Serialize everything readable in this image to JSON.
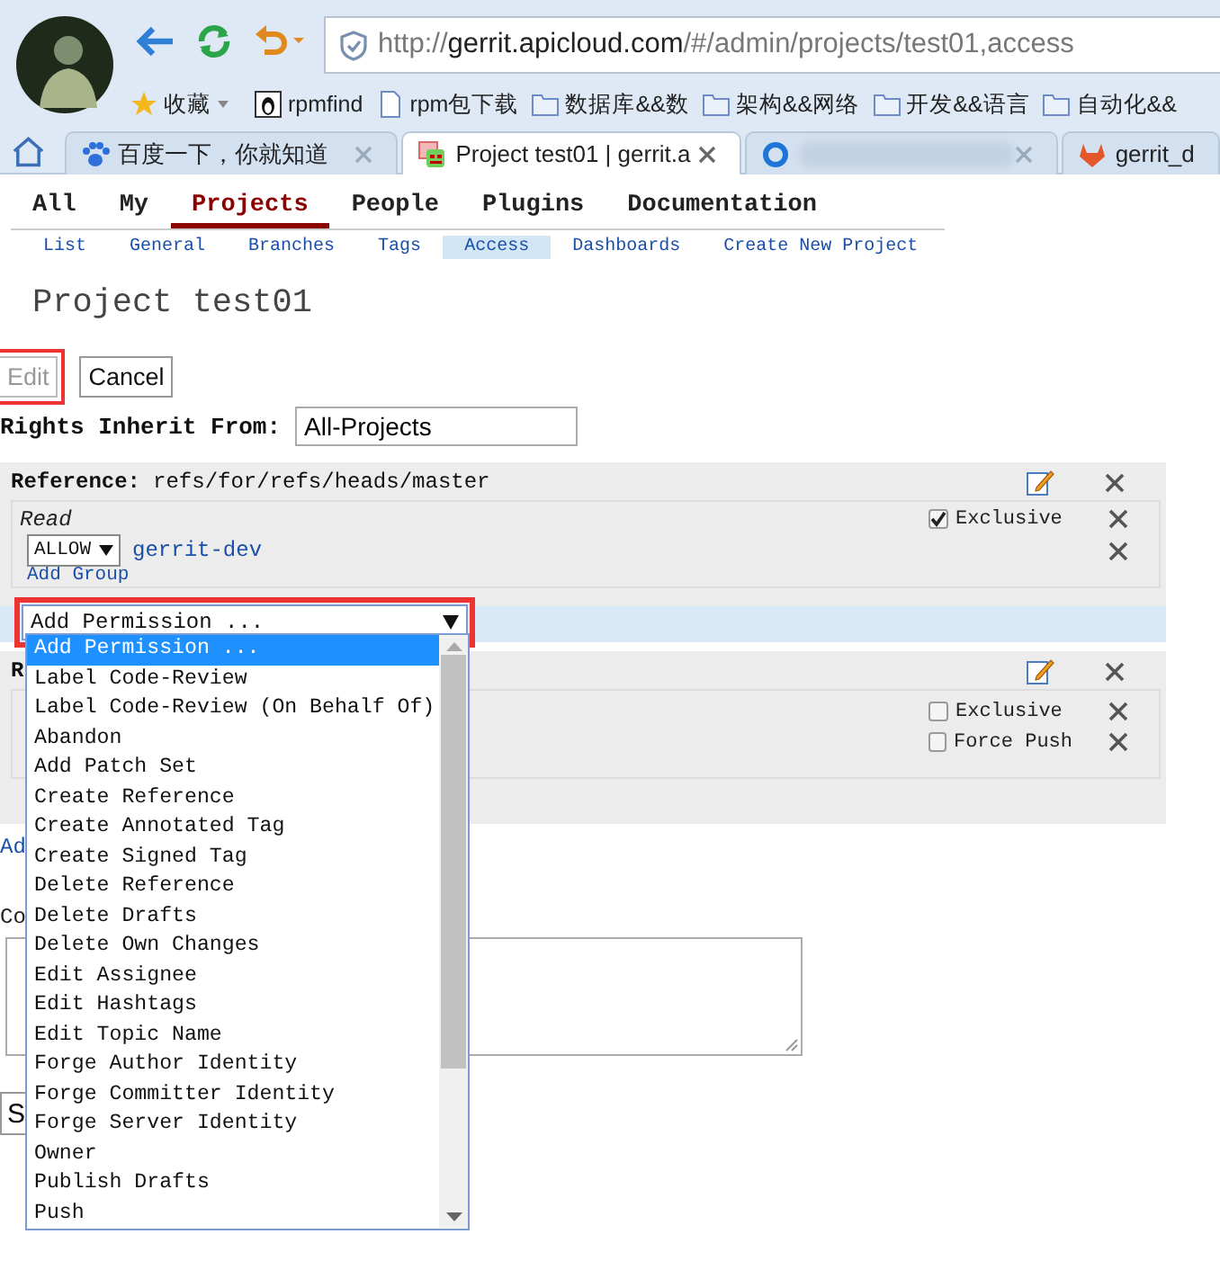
{
  "browser": {
    "address": {
      "scheme": "http://",
      "host": "gerrit.apicloud.com",
      "path": "/#/admin/projects/test01,access"
    },
    "bookmarks": [
      {
        "label": "收藏",
        "kind": "star"
      },
      {
        "label": "rpmfind",
        "kind": "site"
      },
      {
        "label": "rpm包下载",
        "kind": "page"
      },
      {
        "label": "数据库&&数",
        "kind": "folder"
      },
      {
        "label": "架构&&网络",
        "kind": "folder"
      },
      {
        "label": "开发&&语言",
        "kind": "folder"
      },
      {
        "label": "自动化&&",
        "kind": "folder"
      }
    ],
    "tabs": [
      {
        "title": "百度一下，你就知道",
        "kind": "paw",
        "selected": false
      },
      {
        "title": "Project test01 | gerrit.a",
        "kind": "gerrit",
        "selected": true
      },
      {
        "kind": "blurred",
        "selected": false
      },
      {
        "title": "gerrit_d",
        "kind": "fox",
        "selected": false
      }
    ]
  },
  "nav": [
    {
      "label": "All",
      "selected": false
    },
    {
      "label": "My",
      "selected": false
    },
    {
      "label": "Projects",
      "selected": true
    },
    {
      "label": "People",
      "selected": false
    },
    {
      "label": "Plugins",
      "selected": false
    },
    {
      "label": "Documentation",
      "selected": false
    }
  ],
  "subnav": [
    {
      "label": "List",
      "selected": false
    },
    {
      "label": "General",
      "selected": false
    },
    {
      "label": "Branches",
      "selected": false
    },
    {
      "label": "Tags",
      "selected": false
    },
    {
      "label": "Access",
      "selected": true
    },
    {
      "label": "Dashboards",
      "selected": false
    },
    {
      "label": "Create New Project",
      "selected": false
    }
  ],
  "title": "Project test01",
  "buttons": [
    {
      "label": "Edit",
      "disabled": true,
      "highlighted": true
    },
    {
      "label": "Cancel",
      "disabled": false,
      "highlighted": false
    }
  ],
  "inherit": {
    "label": "Rights Inherit From:",
    "value": "All-Projects"
  },
  "references": [
    {
      "label": "Reference:",
      "pattern": "refs/for/refs/heads/master",
      "permission": {
        "name": "Read",
        "options": [
          {
            "label": "Exclusive",
            "checked": true
          }
        ],
        "rules": [
          {
            "action": "ALLOW",
            "group": "gerrit-dev"
          }
        ],
        "add_group": "Add Group"
      },
      "add_permission": {
        "value": "Add Permission ...",
        "highlighted": true
      }
    },
    {
      "label": "R",
      "permission": {
        "options": [
          {
            "label": "Exclusive",
            "checked": false
          },
          {
            "label": "Force Push",
            "checked": false
          }
        ]
      }
    }
  ],
  "add_reference": "Ad",
  "comment_label": "Co",
  "save_button": "S",
  "dropdown": {
    "options": [
      {
        "label": "Add Permission ...",
        "selected": true
      },
      {
        "label": "Label Code-Review",
        "selected": false
      },
      {
        "label": "Label Code-Review (On Behalf Of)",
        "selected": false
      },
      {
        "label": "Abandon",
        "selected": false
      },
      {
        "label": "Add Patch Set",
        "selected": false
      },
      {
        "label": "Create Reference",
        "selected": false
      },
      {
        "label": "Create Annotated Tag",
        "selected": false
      },
      {
        "label": "Create Signed Tag",
        "selected": false
      },
      {
        "label": "Delete Reference",
        "selected": false
      },
      {
        "label": "Delete Drafts",
        "selected": false
      },
      {
        "label": "Delete Own Changes",
        "selected": false
      },
      {
        "label": "Edit Assignee",
        "selected": false
      },
      {
        "label": "Edit Hashtags",
        "selected": false
      },
      {
        "label": "Edit Topic Name",
        "selected": false
      },
      {
        "label": "Forge Author Identity",
        "selected": false
      },
      {
        "label": "Forge Committer Identity",
        "selected": false
      },
      {
        "label": "Forge Server Identity",
        "selected": false
      },
      {
        "label": "Owner",
        "selected": false
      },
      {
        "label": "Publish Drafts",
        "selected": false
      },
      {
        "label": "Push",
        "selected": false
      }
    ]
  }
}
